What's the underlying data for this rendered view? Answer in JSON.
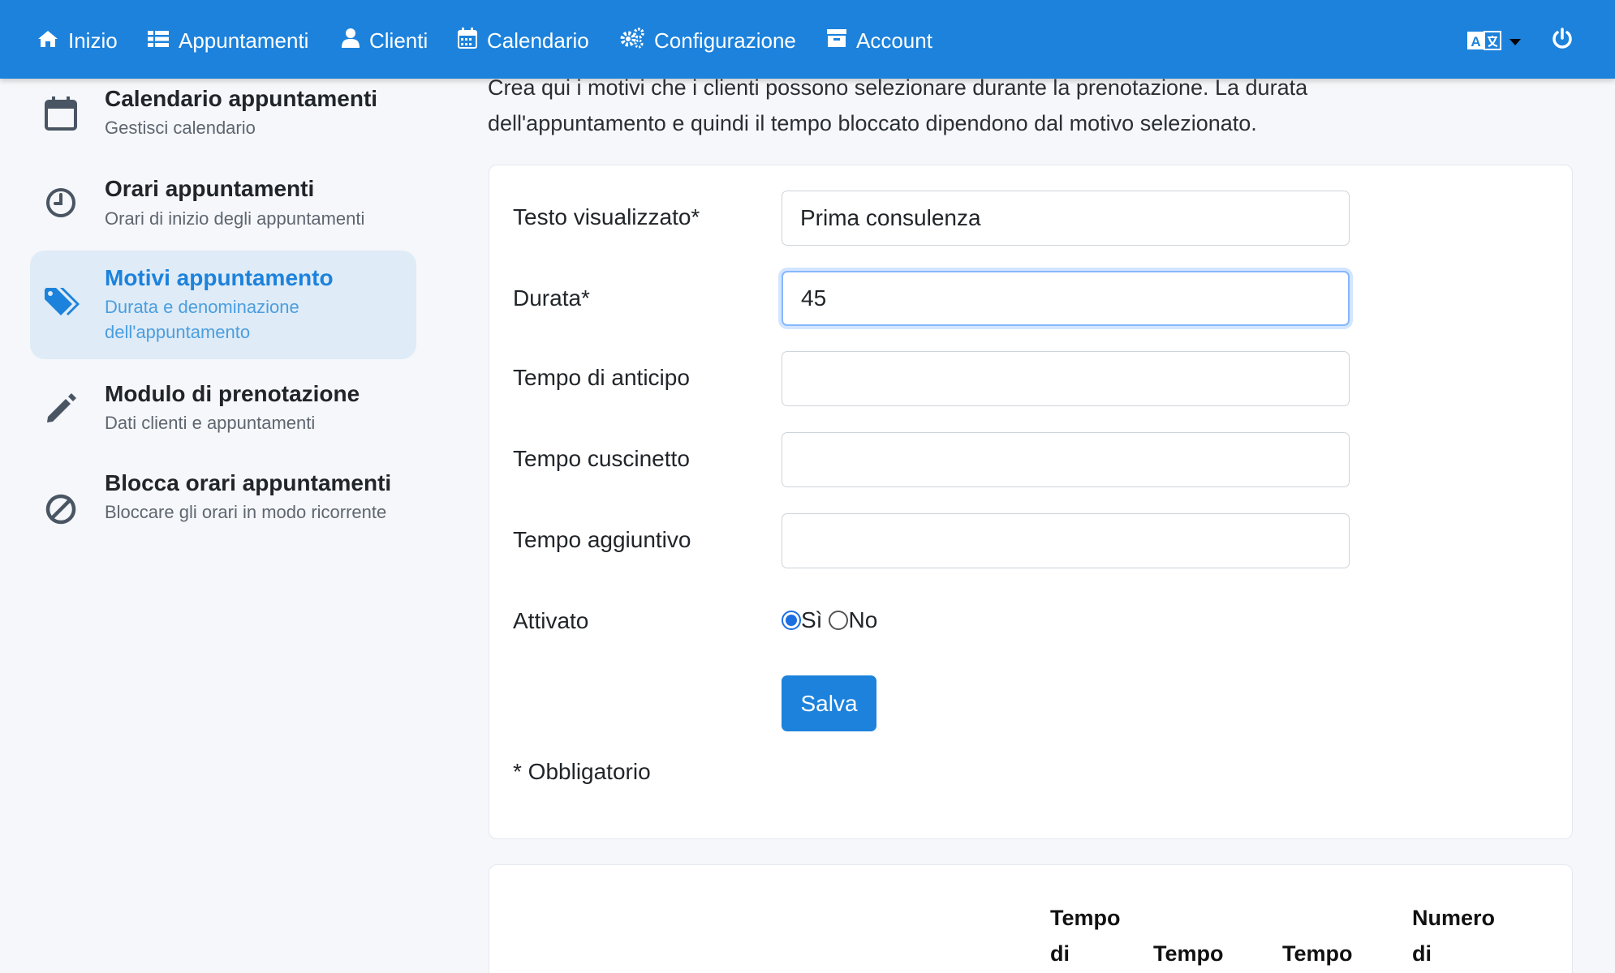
{
  "nav": {
    "items": [
      {
        "label": "Inizio",
        "icon": "home-icon"
      },
      {
        "label": "Appuntamenti",
        "icon": "list-icon"
      },
      {
        "label": "Clienti",
        "icon": "user-icon"
      },
      {
        "label": "Calendario",
        "icon": "calendar-icon"
      },
      {
        "label": "Configurazione",
        "icon": "gears-icon"
      },
      {
        "label": "Account",
        "icon": "archive-icon"
      }
    ],
    "language_icon": "translate-icon",
    "power_icon": "power-icon",
    "color": "#1c82dc"
  },
  "sidebar": {
    "items": [
      {
        "title": "Calendario appuntamenti",
        "subtitle": "Gestisci calendario",
        "icon": "calendar-icon",
        "active": false
      },
      {
        "title": "Orari appuntamenti",
        "subtitle": "Orari di inizio degli appuntamenti",
        "icon": "clock-icon",
        "active": false
      },
      {
        "title": "Motivi appuntamento",
        "subtitle": "Durata e denominazione dell'appuntamento",
        "icon": "tags-icon",
        "active": true
      },
      {
        "title": "Modulo di prenotazione",
        "subtitle": "Dati clienti e appuntamenti",
        "icon": "pencil-icon",
        "active": false
      },
      {
        "title": "Blocca orari appuntamenti",
        "subtitle": "Bloccare gli orari in modo ricorrente",
        "icon": "ban-icon",
        "active": false
      }
    ]
  },
  "main": {
    "intro_line1": "Crea qui i motivi che i clienti possono selezionare durante la prenotazione. La durata",
    "intro_line2": "dell'appuntamento e quindi il tempo bloccato dipendono dal motivo selezionato.",
    "form": {
      "display_text_label": "Testo visualizzato*",
      "display_text_value": "Prima consulenza",
      "duration_label": "Durata*",
      "duration_value": "45",
      "lead_time_label": "Tempo di anticipo",
      "lead_time_value": "",
      "buffer_time_label": "Tempo cuscinetto",
      "buffer_time_value": "",
      "extra_time_label": "Tempo aggiuntivo",
      "extra_time_value": "",
      "active_label": "Attivato",
      "active_yes": "Sì",
      "active_no": "No",
      "active_selected": "Sì",
      "save_label": "Salva",
      "required_note": "* Obbligatorio"
    },
    "table": {
      "headers": [
        {
          "line1": "Tempo",
          "line2": "di"
        },
        {
          "line1": "",
          "line2": "Tempo"
        },
        {
          "line1": "",
          "line2": "Tempo"
        },
        {
          "line1": "Numero",
          "line2": "di"
        }
      ]
    }
  }
}
